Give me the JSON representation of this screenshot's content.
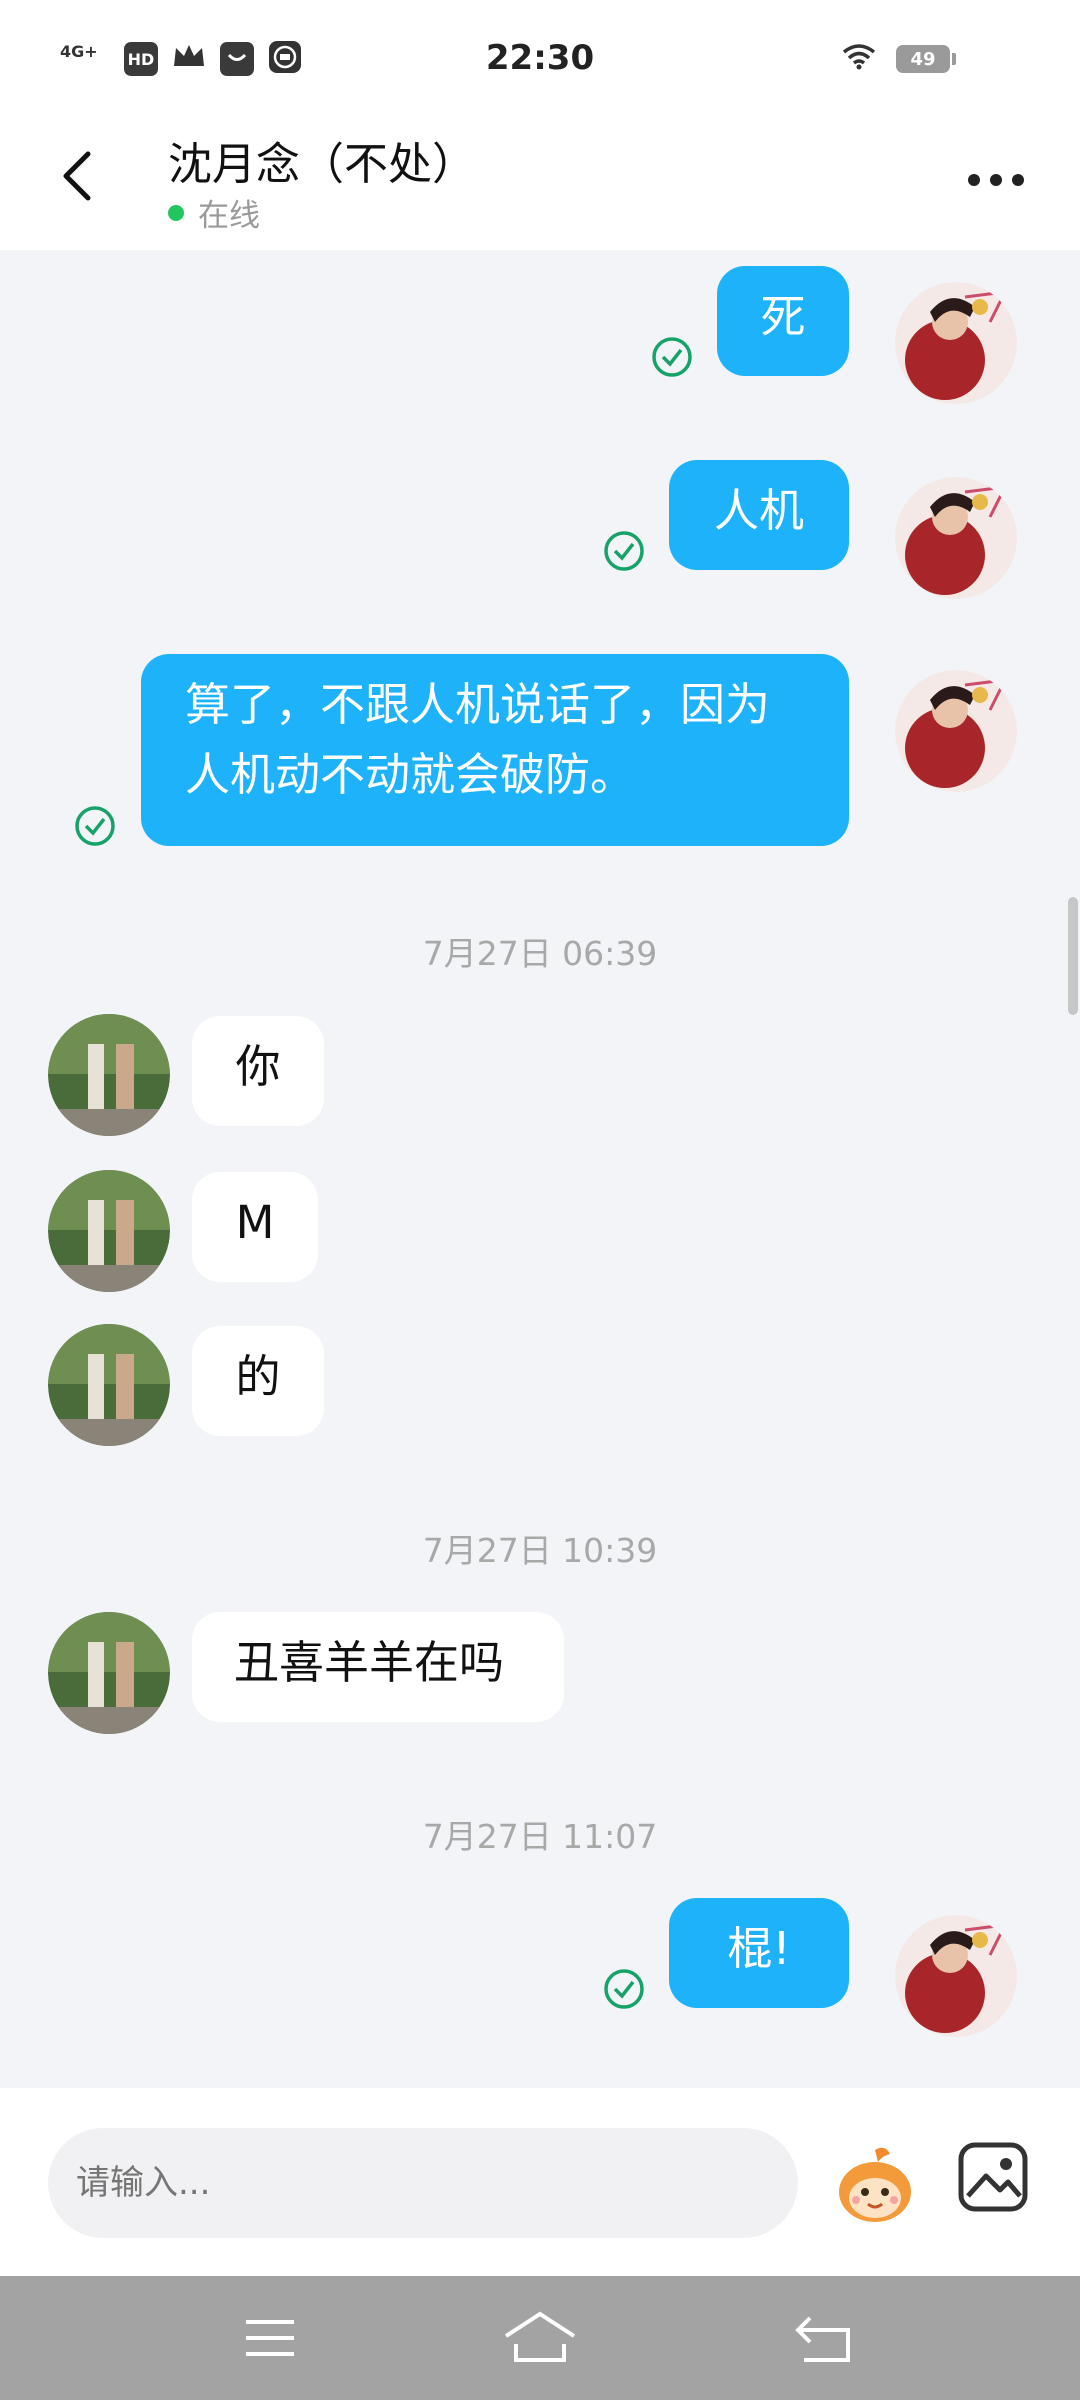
{
  "status_bar": {
    "network": "4G+",
    "hd": "HD",
    "time": "22:30",
    "battery": "49",
    "icons": [
      "signal-icon",
      "hd-icon",
      "crown-icon",
      "bag-icon",
      "app-badge-icon",
      "wifi-icon",
      "battery-icon"
    ]
  },
  "header": {
    "contact_name": "沈月念（不处）",
    "status": "在线",
    "colors": {
      "online": "#22c55e"
    }
  },
  "messages": [
    {
      "dir": "out",
      "text": "死",
      "read": true
    },
    {
      "dir": "out",
      "text": "人机",
      "read": true
    },
    {
      "dir": "out",
      "text": "算了，不跟人机说话了，因为人机动不动就会破防。",
      "read": true
    },
    {
      "type": "time",
      "text": "7月27日 06:39"
    },
    {
      "dir": "in",
      "text": "你"
    },
    {
      "dir": "in",
      "text": "M"
    },
    {
      "dir": "in",
      "text": "的"
    },
    {
      "type": "time",
      "text": "7月27日 10:39"
    },
    {
      "dir": "in",
      "text": "丑喜羊羊在吗"
    },
    {
      "type": "time",
      "text": "7月27日 11:07"
    },
    {
      "dir": "out",
      "text": "棍!",
      "read": true
    }
  ],
  "input": {
    "placeholder": "请输入..."
  },
  "colors": {
    "outgoing_bubble": "#1eb2fa",
    "incoming_bubble": "#ffffff",
    "read_check": "#17a26a"
  }
}
